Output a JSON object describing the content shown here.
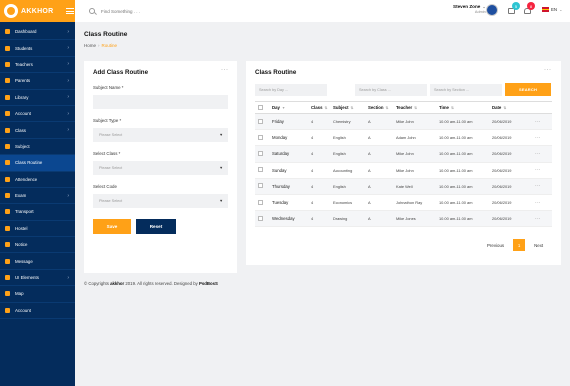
{
  "brand": {
    "name": "AKKHOR"
  },
  "sidebar": {
    "items": [
      {
        "label": "Dashboard",
        "chevron": true,
        "active": false
      },
      {
        "label": "Students",
        "chevron": true,
        "active": false
      },
      {
        "label": "Teachers",
        "chevron": true,
        "active": false
      },
      {
        "label": "Parents",
        "chevron": true,
        "active": false
      },
      {
        "label": "Library",
        "chevron": true,
        "active": false
      },
      {
        "label": "Account",
        "chevron": true,
        "active": false
      },
      {
        "label": "Class",
        "chevron": true,
        "active": false
      },
      {
        "label": "Subject",
        "chevron": false,
        "active": false
      },
      {
        "label": "Class Routine",
        "chevron": false,
        "active": true
      },
      {
        "label": "Attendence",
        "chevron": false,
        "active": false
      },
      {
        "label": "Exam",
        "chevron": true,
        "active": false
      },
      {
        "label": "Transport",
        "chevron": false,
        "active": false
      },
      {
        "label": "Hostel",
        "chevron": false,
        "active": false
      },
      {
        "label": "Notice",
        "chevron": false,
        "active": false
      },
      {
        "label": "Message",
        "chevron": false,
        "active": false
      },
      {
        "label": "UI Elements",
        "chevron": true,
        "active": false
      },
      {
        "label": "Map",
        "chevron": false,
        "active": false
      },
      {
        "label": "Account",
        "chevron": false,
        "active": false
      }
    ]
  },
  "topbar": {
    "search_placeholder": "Find Something . . .",
    "user_name": "Steven Zone",
    "user_role": "Admin",
    "message_count": "5",
    "notification_count": "8",
    "language": "EN"
  },
  "page": {
    "title": "Class Routine",
    "breadcrumb_home": "Home",
    "breadcrumb_current": "Routine"
  },
  "form": {
    "title": "Add Class Routine",
    "subject_name_label": "Subject Name *",
    "subject_type_label": "Subject Type *",
    "select_class_label": "Select Class *",
    "select_code_label": "Select Code",
    "select_placeholder": "Please Select",
    "save_label": "Save",
    "reset_label": "Reset"
  },
  "routine": {
    "title": "Class Routine",
    "filter_day": "Search by Day ...",
    "filter_class": "Search by Class ...",
    "filter_section": "Search by Section ...",
    "search_label": "SEARCH",
    "columns": [
      "Day",
      "Class",
      "Subject",
      "Section",
      "Teacher",
      "Time",
      "Date"
    ],
    "rows": [
      {
        "day": "Friday",
        "class": "4",
        "subject": "Chemistry",
        "section": "A",
        "teacher": "Mike John",
        "time": "10.00 am-11.00 am",
        "date": "20/06/2019"
      },
      {
        "day": "Monday",
        "class": "4",
        "subject": "English",
        "section": "A",
        "teacher": "Adam John",
        "time": "10.00 am-11.00 am",
        "date": "20/06/2019"
      },
      {
        "day": "Saturday",
        "class": "4",
        "subject": "English",
        "section": "A",
        "teacher": "Mike John",
        "time": "10.00 am-11.00 am",
        "date": "20/06/2019"
      },
      {
        "day": "Sunday",
        "class": "4",
        "subject": "Accounting",
        "section": "A",
        "teacher": "Mike John",
        "time": "10.00 am-11.00 am",
        "date": "20/06/2019"
      },
      {
        "day": "Thursday",
        "class": "4",
        "subject": "English",
        "section": "A",
        "teacher": "Kate Well",
        "time": "10.00 am-11.00 am",
        "date": "20/06/2019"
      },
      {
        "day": "Tuesday",
        "class": "4",
        "subject": "Economics",
        "section": "A",
        "teacher": "Johnathon Ray",
        "time": "10.00 am-11.00 am",
        "date": "20/06/2019"
      },
      {
        "day": "Wednesday",
        "class": "4",
        "subject": "Drawing",
        "section": "A",
        "teacher": "Mike Jones",
        "time": "10.00 am-11.00 am",
        "date": "20/06/2019"
      }
    ],
    "pager_previous": "Previous",
    "pager_current": "1",
    "pager_next": "Next"
  },
  "footer": {
    "prefix": "© Copyrights",
    "brand": "akkhor",
    "middle": "2019. All rights reserved. Designed by",
    "designer": "PsdBosS"
  },
  "colors": {
    "accent": "#ffa117",
    "sidebar": "#042c5c",
    "reset_button": "#042c5c"
  }
}
